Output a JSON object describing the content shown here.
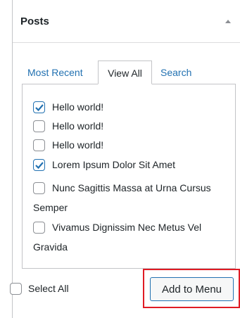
{
  "panel": {
    "title": "Posts",
    "collapse_icon": "triangle-up-icon"
  },
  "tabs": [
    {
      "label": "Most Recent",
      "active": false
    },
    {
      "label": "View All",
      "active": true
    },
    {
      "label": "Search",
      "active": false
    }
  ],
  "items": [
    {
      "label": "Hello world!",
      "checked": true
    },
    {
      "label": "Hello world!",
      "checked": false
    },
    {
      "label": "Hello world!",
      "checked": false
    },
    {
      "label": "Lorem Ipsum Dolor Sit Amet",
      "checked": true
    },
    {
      "label_line1": "Nunc Sagittis Massa at Urna Cursus",
      "label_line2": "Semper",
      "checked": false
    },
    {
      "label_line1": "Vivamus Dignissim Nec Metus Vel",
      "label_line2": "Gravida",
      "checked": false
    }
  ],
  "footer": {
    "select_all_label": "Select All",
    "add_button_label": "Add to Menu"
  },
  "colors": {
    "accent": "#2271b1",
    "highlight": "#e01b24",
    "border": "#c3c4c7"
  }
}
